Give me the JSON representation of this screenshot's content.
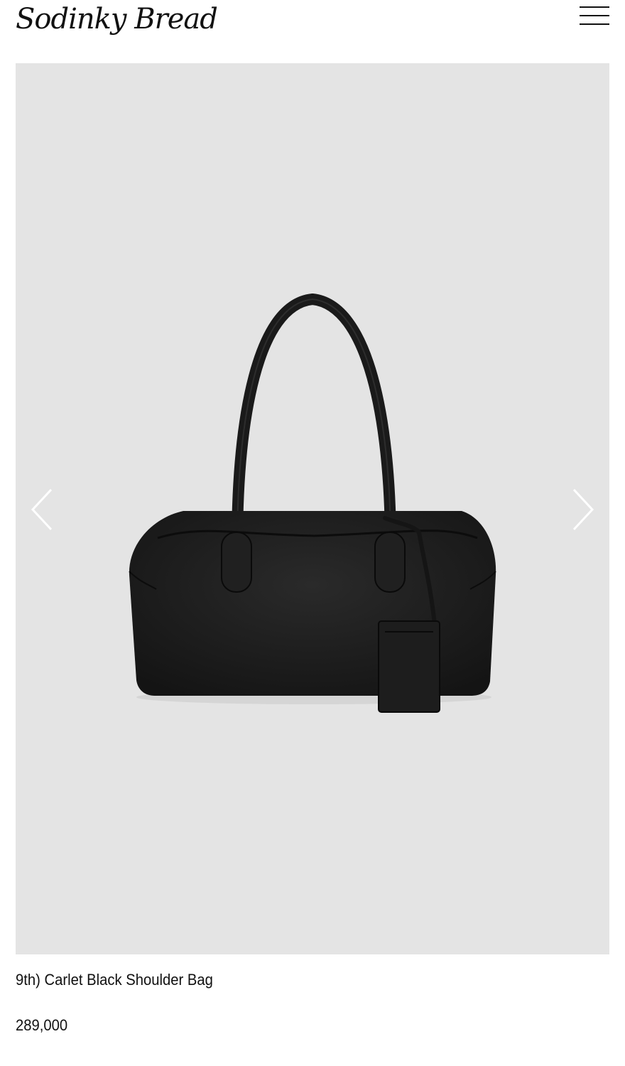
{
  "header": {
    "logo_text": "Sodinky Bread",
    "menu_icon": "hamburger-menu-icon"
  },
  "gallery": {
    "image_subject": "black leather shoulder bag",
    "prev_icon": "chevron-left-icon",
    "next_icon": "chevron-right-icon"
  },
  "product": {
    "name": "9th) Carlet Black Shoulder Bag",
    "price": "289,000"
  },
  "colors": {
    "background": "#ffffff",
    "gallery_background": "#e4e4e4",
    "text": "#111111",
    "bag": "#1c1c1c"
  }
}
